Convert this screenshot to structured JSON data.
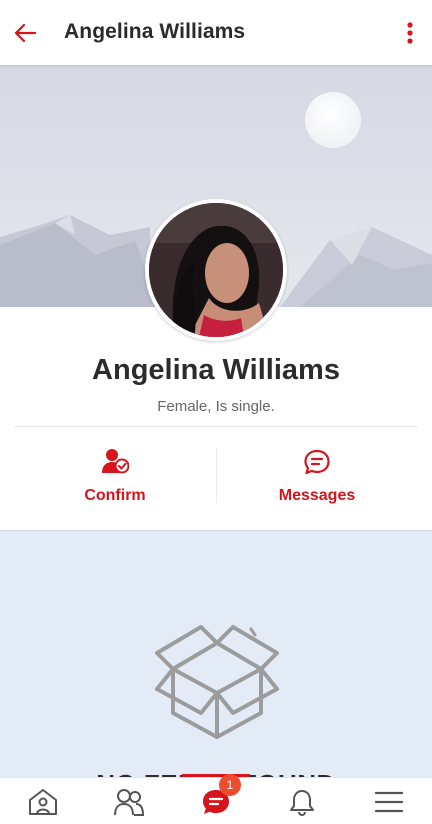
{
  "header": {
    "title": "Angelina Williams"
  },
  "profile": {
    "name": "Angelina Williams",
    "subtitle": "Female, Is single."
  },
  "actions": [
    {
      "label": "Confirm",
      "icon": "user-confirm-icon"
    },
    {
      "label": "Messages",
      "icon": "message-icon"
    }
  ],
  "feed": {
    "empty_text": "NO FEEDS FOUND",
    "icon": "empty-box-icon"
  },
  "nav": {
    "items": [
      "home-icon",
      "friends-icon",
      "messages-icon",
      "notifications-icon",
      "menu-icon"
    ],
    "badge": "1"
  },
  "colors": {
    "accent": "#d7141b",
    "badge": "#ee4d2d",
    "feed_bg": "#e3ebf6",
    "cover_bg": "#dfe1ea"
  }
}
